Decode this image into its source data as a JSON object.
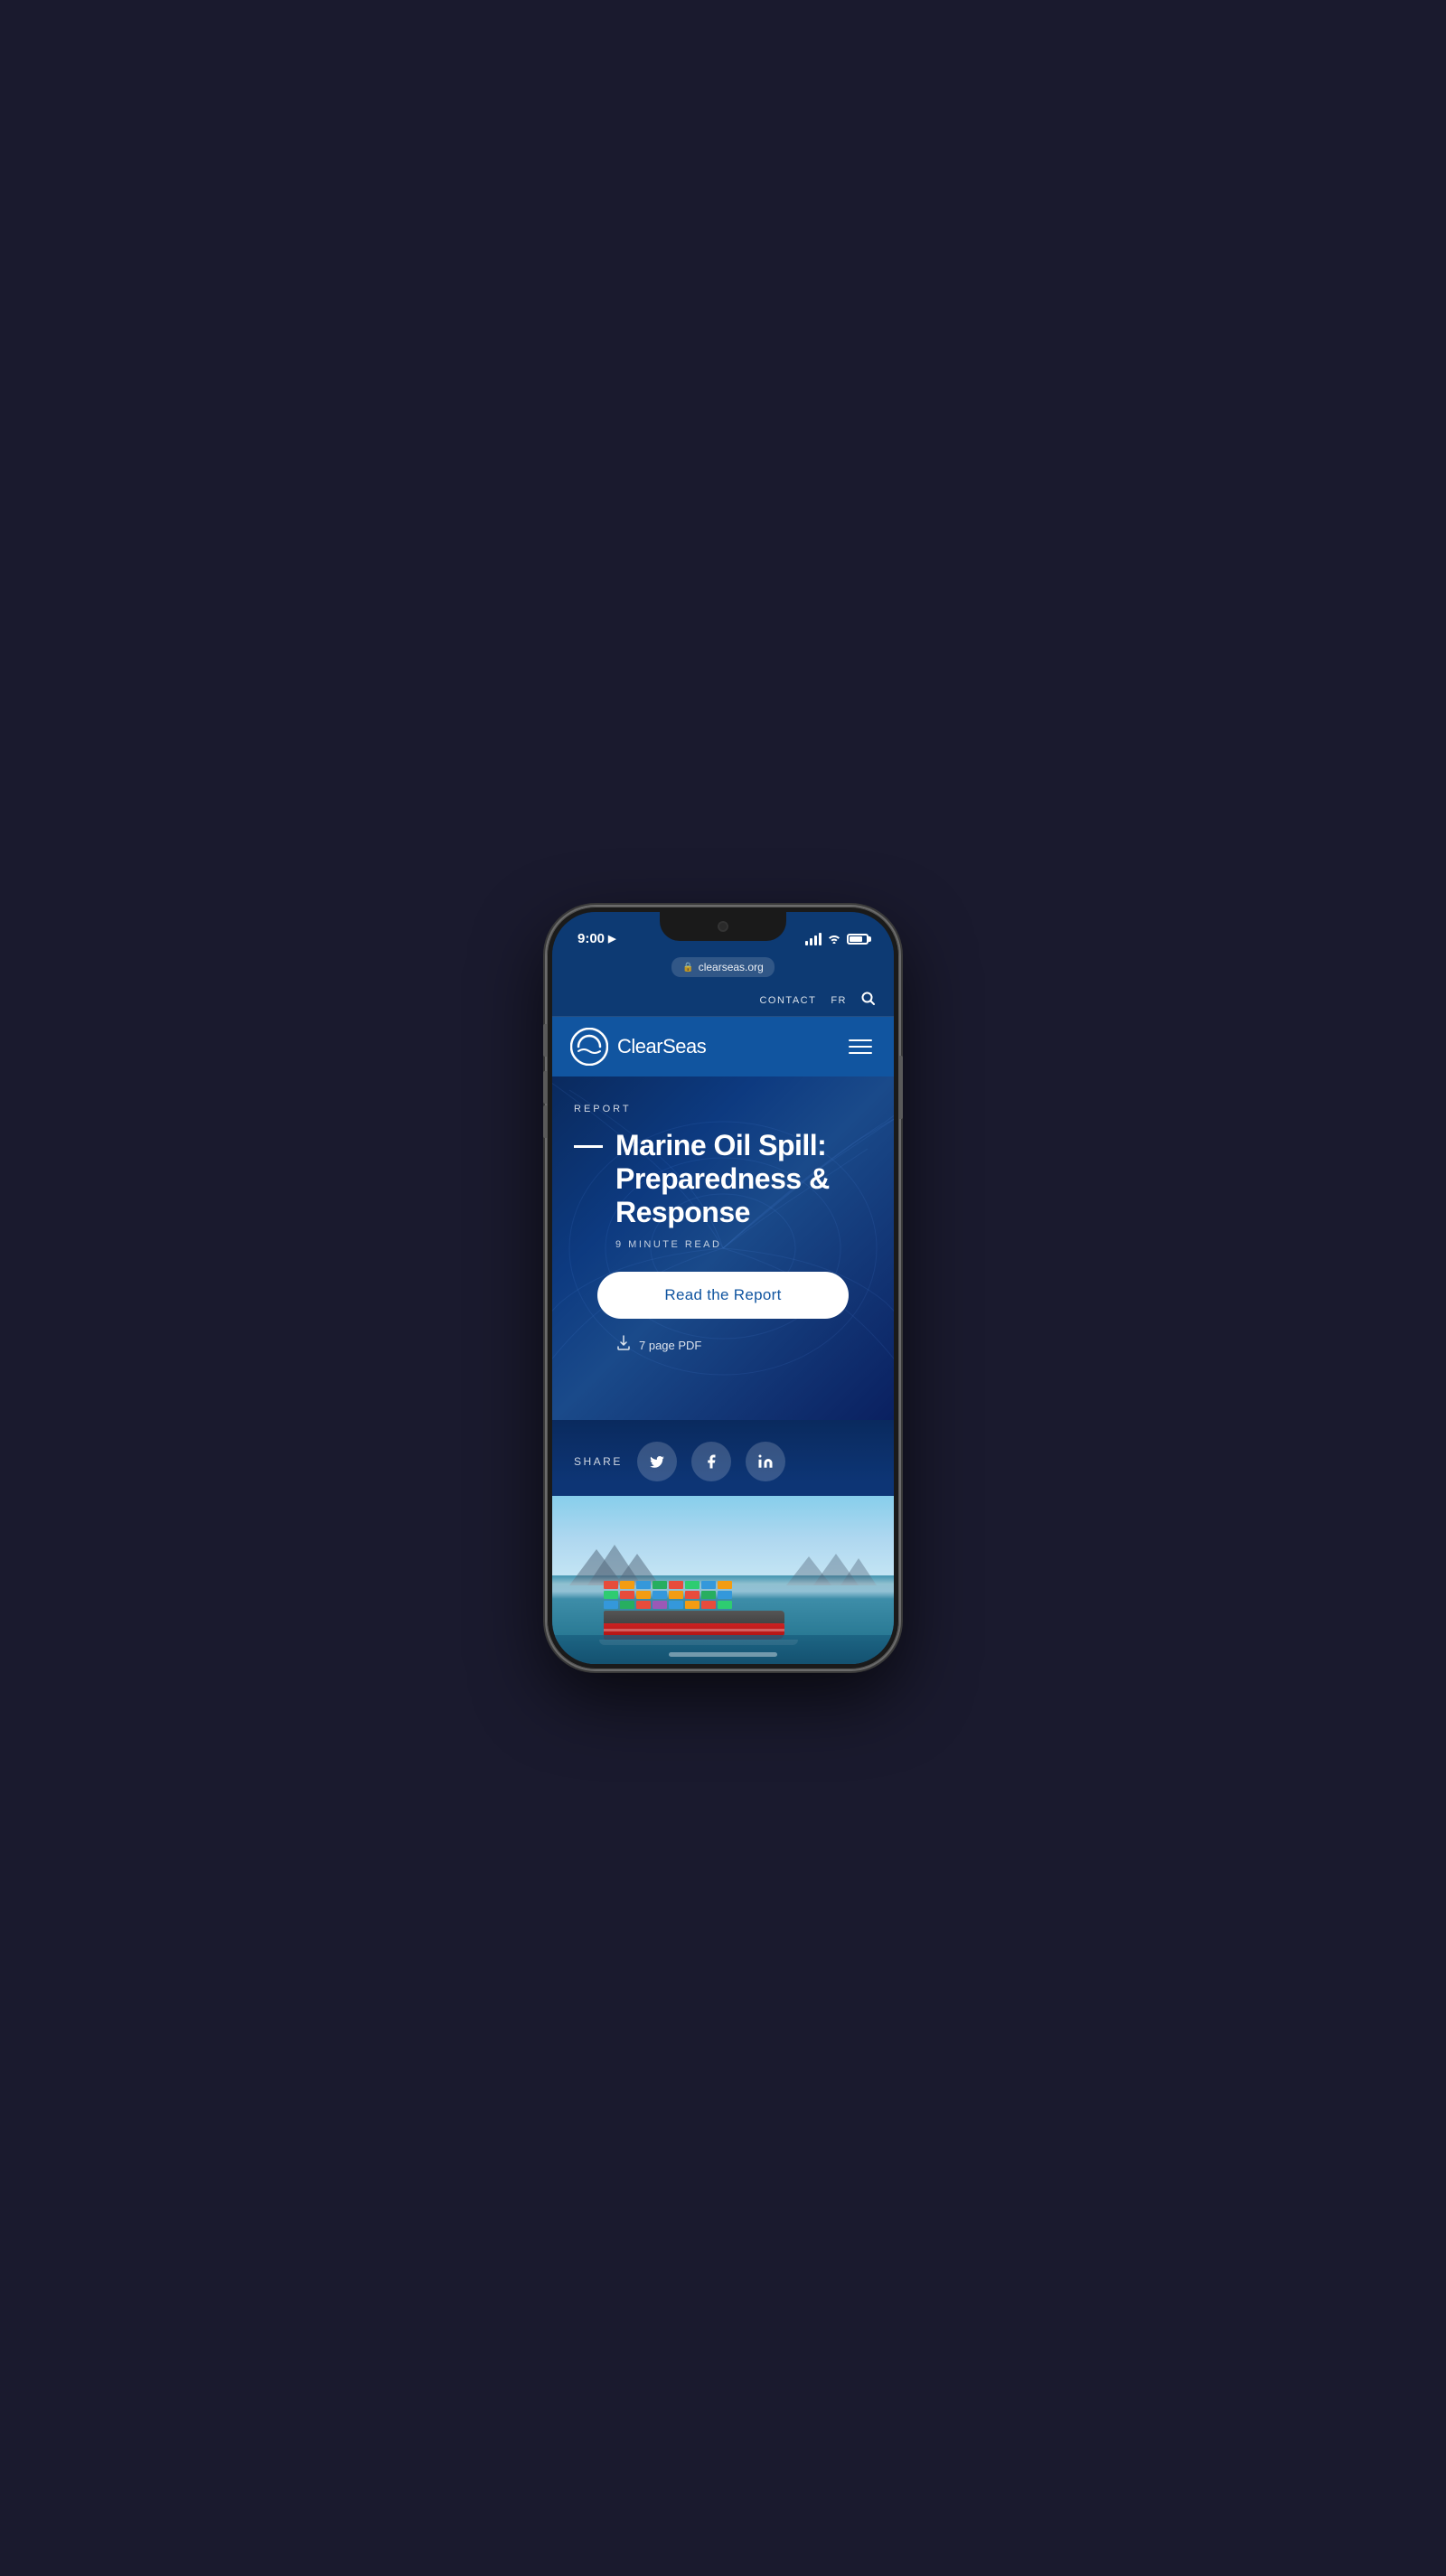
{
  "device": {
    "time": "9:00",
    "url": "clearseas.org",
    "nav_items": [
      "CONTACT",
      "FR"
    ],
    "home_indicator": true
  },
  "site": {
    "logo_text": "ClearSeas",
    "logo_icon": "C"
  },
  "hero": {
    "category": "REPORT",
    "title": "Marine Oil Spill: Preparedness & Response",
    "read_time": "9 MINUTE READ",
    "cta_button": "Read the Report",
    "pdf_label": "7 page PDF",
    "share_label": "SHARE"
  },
  "social": {
    "twitter_label": "Twitter",
    "facebook_label": "Facebook",
    "linkedin_label": "LinkedIn"
  },
  "colors": {
    "primary_blue": "#1155a0",
    "dark_blue": "#0a2a5e",
    "medium_blue": "#0d3a73",
    "nav_blue": "#1155a0",
    "white": "#ffffff",
    "accent": "#1a6ec8"
  }
}
